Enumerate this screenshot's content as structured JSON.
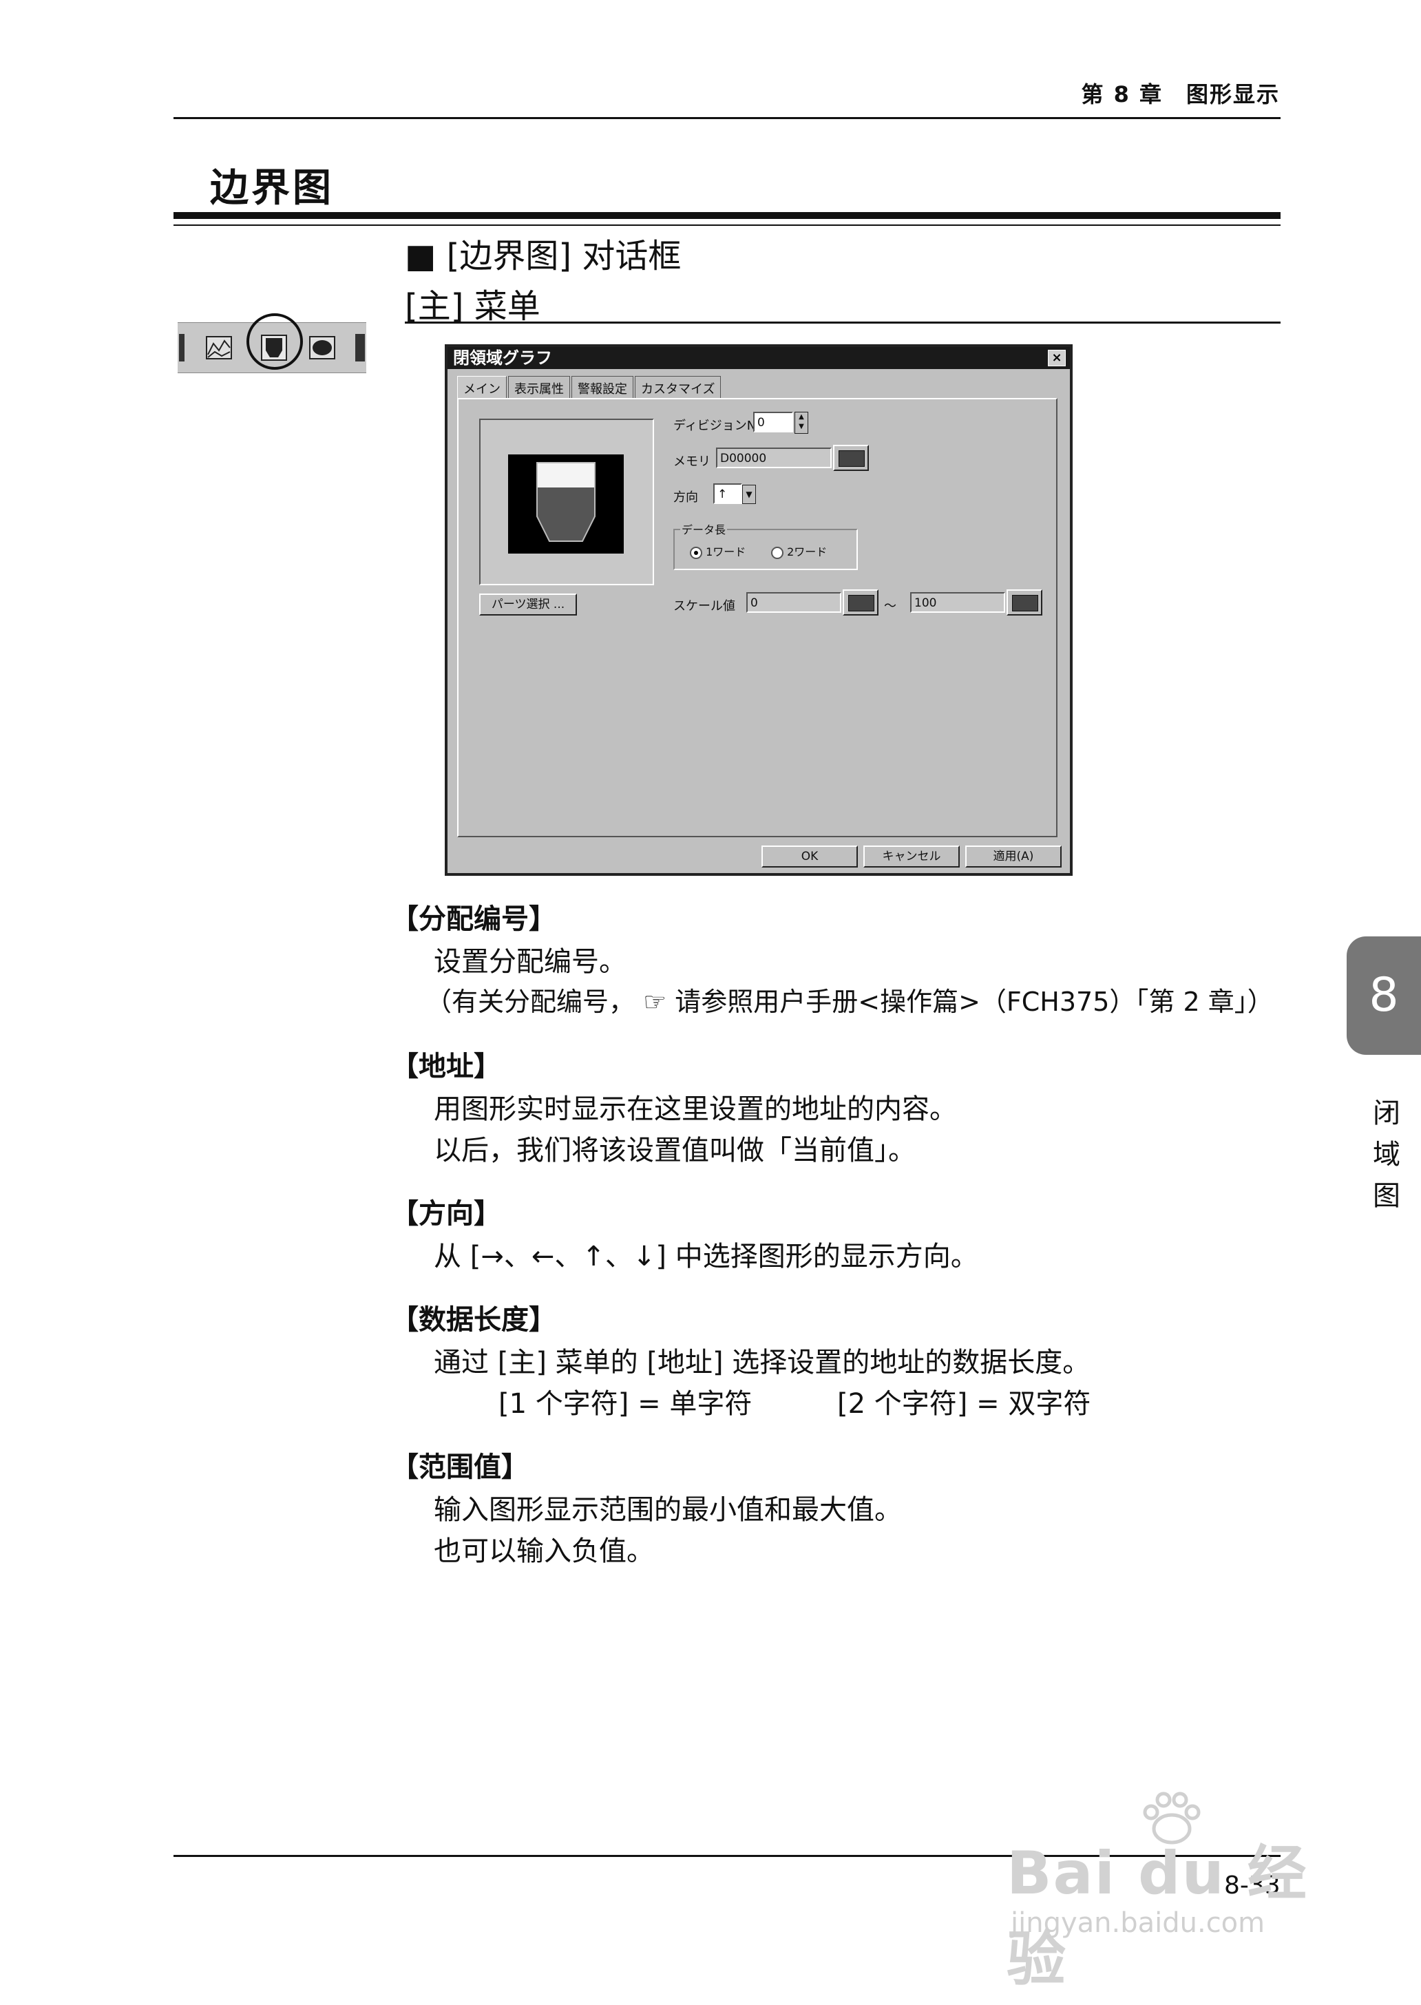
{
  "header": {
    "chapter": "第 8 章　图形显示"
  },
  "title": "边界图",
  "section": {
    "dialog_heading": "■ [边界图] 对话框",
    "menu_heading": "[主] 菜单"
  },
  "dialog": {
    "title": "閉領域グラフ",
    "close": "×",
    "tabs": [
      "メイン",
      "表示属性",
      "警報設定",
      "カスタマイズ"
    ],
    "division_label": "ディビジョンNo",
    "division_value": "0",
    "memory_label": "メモリ",
    "memory_value": "D00000",
    "direction_label": "方向",
    "direction_value": "↑",
    "data_length_label": "データ長",
    "radio_1word": "1ワード",
    "radio_2word": "2ワード",
    "parts_button": "パーツ選択 ...",
    "scale_label": "スケール値",
    "scale_min": "0",
    "scale_tilde": "～",
    "scale_max": "100",
    "ok": "OK",
    "cancel": "キャンセル",
    "apply": "適用(A)"
  },
  "sections": [
    {
      "heading": "【分配编号】",
      "lines": [
        "设置分配编号。",
        "（有关分配编号， ☞ 请参照用户手册<操作篇>（FCH375）「第 2 章」）"
      ]
    },
    {
      "heading": "【地址】",
      "lines": [
        "用图形实时显示在这里设置的地址的内容。",
        "以后，我们将该设置值叫做「当前值」。"
      ]
    },
    {
      "heading": "【方向】",
      "lines": [
        "从 [→、←、↑、↓] 中选择图形的显示方向。"
      ]
    },
    {
      "heading": "【数据长度】",
      "lines": [
        "通过 [主] 菜单的 [地址] 选择设置的地址的数据长度。",
        "[1 个字符] = 单字符",
        "[2 个字符] = 双字符"
      ]
    },
    {
      "heading": "【范围值】",
      "lines": [
        "输入图形显示范围的最小值和最大值。",
        "也可以输入负值。"
      ]
    }
  ],
  "side_tab": {
    "number": "8",
    "chars": [
      "闭",
      "域",
      "图"
    ]
  },
  "footer": {
    "page": "8-33"
  },
  "watermark": {
    "logo": "Bai du 经验",
    "url": "jingyan.baidu.com"
  }
}
